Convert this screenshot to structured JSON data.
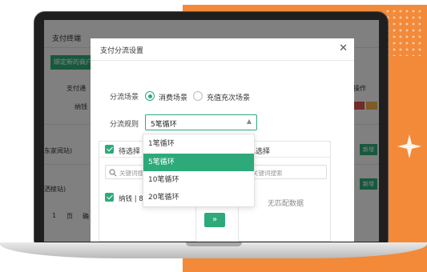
{
  "background_app": {
    "title": "支付终端",
    "bind_button": "绑定新的商户",
    "col_channel": "支付通",
    "col_nayong": "纳钱",
    "col_ops": "操作",
    "row1_store": "东家阅站)",
    "row2_store": "洒棱站)",
    "row_btn": "新增",
    "pager_1": "1",
    "pager_page": "页",
    "pager_confirm": "确"
  },
  "modal": {
    "title": "支付分流设置",
    "scene_label": "分流场景",
    "scene_options": [
      "消费场景",
      "充值充次场景"
    ],
    "scene_selected": 0,
    "rule_label": "分流规则",
    "rule_value": "5笔循环",
    "rule_options": [
      "1笔循环",
      "5笔循环",
      "10笔循环",
      "20笔循环"
    ],
    "rule_selected": 1
  },
  "transfer": {
    "left_title": "待选择",
    "left_search_placeholder": "关键词搜",
    "left_item": "纳钱 | 85",
    "right_title": "已选择",
    "right_search_placeholder": "关键词搜索",
    "right_empty": "无匹配数据",
    "move_icon": "double-chevron-right-icon"
  },
  "colors": {
    "accent": "#2eaa7a",
    "backdrop": "#f28a3a"
  }
}
